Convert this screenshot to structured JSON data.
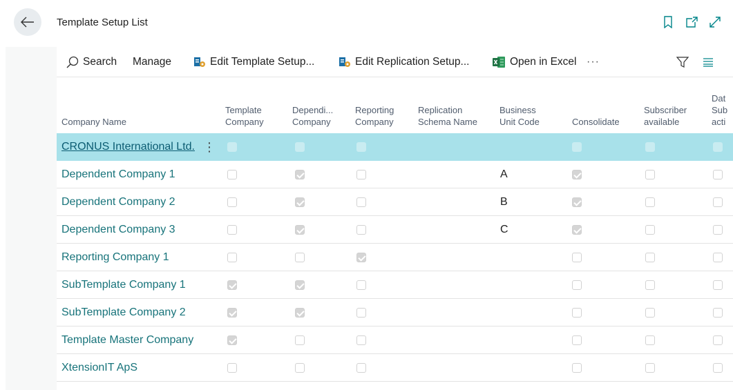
{
  "header": {
    "title": "Template Setup List"
  },
  "toolbar": {
    "search_label": "Search",
    "manage_label": "Manage",
    "edit_template_label": "Edit Template Setup...",
    "edit_replication_label": "Edit Replication Setup...",
    "open_excel_label": "Open in Excel",
    "more_label": "···"
  },
  "columns": {
    "company_name": "Company Name",
    "template_company": "Template\nCompany",
    "dependent_company": "Dependi...\nCompany",
    "reporting_company": "Reporting\nCompany",
    "replication_schema": "Replication\nSchema Name",
    "business_unit": "Business\nUnit Code",
    "consolidate": "Consolidate",
    "subscriber": "Subscriber\navailable",
    "data_sub": "Dat\nSub\nacti"
  },
  "rows": [
    {
      "name": "CRONUS International Ltd.",
      "template": false,
      "dependent": false,
      "reporting": false,
      "business_unit": "",
      "consolidate": false,
      "subscriber": false,
      "data_sub": false,
      "selected": true
    },
    {
      "name": "Dependent Company 1",
      "template": false,
      "dependent": true,
      "reporting": false,
      "business_unit": "A",
      "consolidate": true,
      "subscriber": false,
      "data_sub": false
    },
    {
      "name": "Dependent Company 2",
      "template": false,
      "dependent": true,
      "reporting": false,
      "business_unit": "B",
      "consolidate": true,
      "subscriber": false,
      "data_sub": false
    },
    {
      "name": "Dependent Company 3",
      "template": false,
      "dependent": true,
      "reporting": false,
      "business_unit": "C",
      "consolidate": true,
      "subscriber": false,
      "data_sub": false
    },
    {
      "name": "Reporting Company 1",
      "template": false,
      "dependent": false,
      "reporting": true,
      "business_unit": "",
      "consolidate": false,
      "subscriber": false,
      "data_sub": false
    },
    {
      "name": "SubTemplate Company 1",
      "template": true,
      "dependent": true,
      "reporting": false,
      "business_unit": "",
      "consolidate": false,
      "subscriber": false,
      "data_sub": false
    },
    {
      "name": "SubTemplate Company 2",
      "template": true,
      "dependent": true,
      "reporting": false,
      "business_unit": "",
      "consolidate": false,
      "subscriber": false,
      "data_sub": false
    },
    {
      "name": "Template Master Company",
      "template": true,
      "dependent": false,
      "reporting": false,
      "business_unit": "",
      "consolidate": false,
      "subscriber": false,
      "data_sub": false
    },
    {
      "name": "XtensionIT ApS",
      "template": false,
      "dependent": false,
      "reporting": false,
      "business_unit": "",
      "consolidate": false,
      "subscriber": false,
      "data_sub": false
    }
  ],
  "colors": {
    "accent": "#17737a",
    "selected_row": "#a8e1ea",
    "excel_green": "#1f7244",
    "bookmark_teal": "#008489"
  },
  "icons": [
    "back-arrow-icon",
    "bookmark-icon",
    "open-new-window-icon",
    "expand-icon",
    "search-icon",
    "edit-setup-icon",
    "excel-icon",
    "filter-icon",
    "list-view-icon",
    "row-menu-icon"
  ]
}
